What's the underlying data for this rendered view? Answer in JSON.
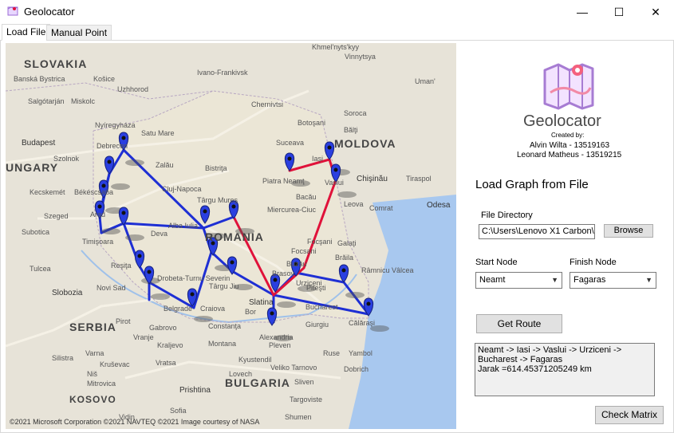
{
  "window": {
    "title": "Geolocator",
    "controls": {
      "minimize": "—",
      "maximize": "☐",
      "close": "✕"
    }
  },
  "tabs": [
    {
      "label": "Load File",
      "active": true
    },
    {
      "label": "Manual Point",
      "active": false
    }
  ],
  "map": {
    "countries": [
      "SLOVAKIA",
      "UNGARY",
      "ROMANIA",
      "SERBIA",
      "BULGARIA",
      "KOSOVO",
      "MOLDOVA"
    ],
    "cities": [
      "Banská Bystrica",
      "Košice",
      "Uzhhorod",
      "Salgótarján",
      "Miskolc",
      "Ivano-Frankivsk",
      "Chernivtsi",
      "Vinnytsya",
      "Uman'",
      "Khmel'nyts'kyy",
      "Nyíregyháza",
      "Satu Mare",
      "Botoşani",
      "Soroca",
      "Bălţi",
      "Budapest",
      "Debrecen",
      "Suceava",
      "Szolnok",
      "Zalău",
      "Bistriţa",
      "Piatra Neamţ",
      "Chişinău",
      "Tiraspol",
      "Kecskemét",
      "Békéscsaba",
      "Cluj-Napoca",
      "Bacău",
      "Comrat",
      "Odesa",
      "Szeged",
      "Târgu Mureş",
      "Miercurea-Ciuc",
      "Leova",
      "Subotica",
      "Arad",
      "Alba Iulia",
      "Galaţi",
      "Timişoara",
      "Deva",
      "Brăila",
      "Reşiţa",
      "Râmnicu Vâlcea",
      "Tulcea",
      "Novi Sad",
      "Drobeta-Turnu Severin",
      "Târgu Jiu",
      "Piteşti",
      "Slobozia",
      "Belgrade",
      "Craiova",
      "Slatina",
      "Bucharest",
      "Călăraşi",
      "Constanţa",
      "Alexandria",
      "Giurgiu",
      "Silistra",
      "Kraljevo",
      "Montana",
      "Pleven",
      "Ruse",
      "Dobrich",
      "Varna",
      "Kruševac",
      "Niš",
      "Mitrovica",
      "Prishtina",
      "Sofia",
      "Kyustendil",
      "Veliko Tarnovo",
      "Targoviste",
      "Shumen",
      "Sliven",
      "Yambol",
      "Vratsa",
      "Lovech",
      "Gabrovo",
      "Pirot",
      "Vidin",
      "Vranje",
      "Bor",
      "Brasov",
      "Focşani",
      "Iaşi",
      "Vaslui",
      "Urziceni",
      "Focsani",
      "Buzău"
    ],
    "copyright": "©2021 Microsoft Corporation ©2021 NAVTEQ ©2021 Image courtesy of NASA"
  },
  "branding": {
    "title": "Geolocator",
    "created_by": "Created by:",
    "author1": "Alvin Wilta - 13519163",
    "author2": "Leonard Matheus - 13519215"
  },
  "form": {
    "section_title": "Load Graph from File",
    "file_dir_label": "File Directory",
    "file_path": "C:\\Users\\Lenovo X1 Carbon\\",
    "browse_label": "Browse",
    "start_label": "Start Node",
    "start_value": "Neamt",
    "finish_label": "Finish Node",
    "finish_value": "Fagaras",
    "get_route_label": "Get Route",
    "result_lines": [
      "Neamt -> Iasi -> Vaslui -> Urziceni ->",
      "Bucharest -> Fagaras",
      "Jarak =614.45371205249 km"
    ],
    "check_matrix_label": "Check Matrix"
  },
  "colors": {
    "route": "#e0123a",
    "edges": "#1e2fd4",
    "pin": "#2a3fe0",
    "sea": "#a8c8ef"
  }
}
